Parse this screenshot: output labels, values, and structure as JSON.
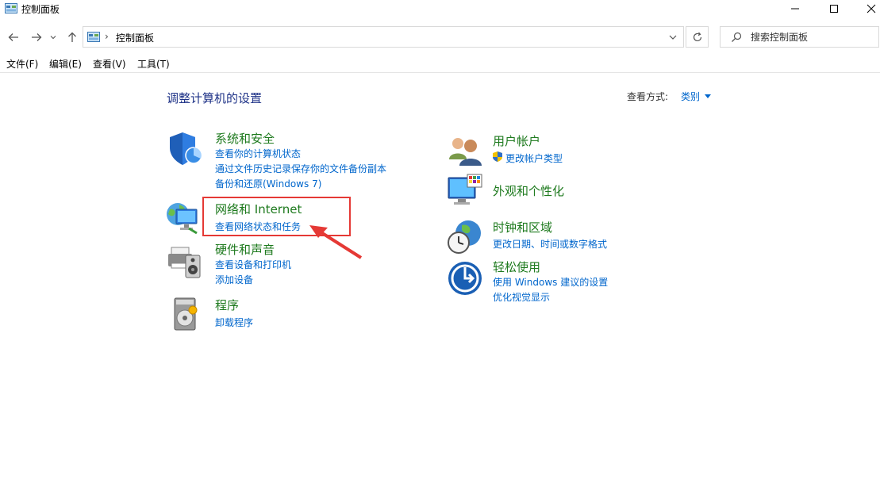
{
  "window": {
    "title": "控制面板",
    "minimize_icon": "minimize-icon",
    "maximize_icon": "maximize-icon",
    "close_icon": "close-icon"
  },
  "nav": {
    "breadcrumb": "控制面板",
    "search_placeholder": "搜索控制面板"
  },
  "menu": {
    "file": "文件(F)",
    "edit": "编辑(E)",
    "view": "查看(V)",
    "tools": "工具(T)"
  },
  "content": {
    "heading": "调整计算机的设置",
    "view_by_label": "查看方式:",
    "view_by_value": "类别"
  },
  "categories": {
    "system_security": {
      "title": "系统和安全",
      "links": [
        "查看你的计算机状态",
        "通过文件历史记录保存你的文件备份副本",
        "备份和还原(Windows 7)"
      ]
    },
    "network": {
      "title": "网络和 Internet",
      "links": [
        "查看网络状态和任务"
      ]
    },
    "hardware": {
      "title": "硬件和声音",
      "links": [
        "查看设备和打印机",
        "添加设备"
      ]
    },
    "programs": {
      "title": "程序",
      "links": [
        "卸载程序"
      ]
    },
    "user_accounts": {
      "title": "用户帐户",
      "links": [
        "更改帐户类型"
      ]
    },
    "appearance": {
      "title": "外观和个性化",
      "links": []
    },
    "clock_region": {
      "title": "时钟和区域",
      "links": [
        "更改日期、时间或数字格式"
      ]
    },
    "ease_of_access": {
      "title": "轻松使用",
      "links": [
        "使用 Windows 建议的设置",
        "优化视觉显示"
      ]
    }
  },
  "colors": {
    "category_title": "#1e7a1e",
    "link": "#0066cc",
    "heading": "#1e3287",
    "annotation": "#e53935"
  }
}
